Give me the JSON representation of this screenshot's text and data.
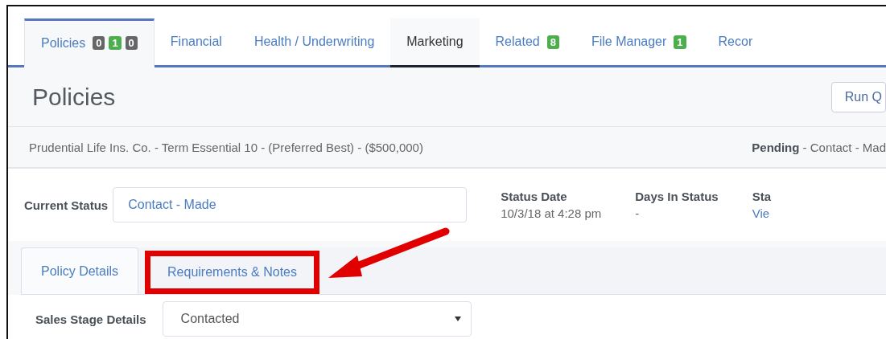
{
  "tabs": [
    {
      "label": "Policies",
      "selected": true,
      "highlighted": false,
      "badges": [
        {
          "text": "0",
          "color": "#666666"
        },
        {
          "text": "1",
          "color": "#4cae4c"
        },
        {
          "text": "0",
          "color": "#666666"
        }
      ]
    },
    {
      "label": "Financial",
      "selected": false,
      "highlighted": false
    },
    {
      "label": "Health / Underwriting",
      "selected": false,
      "highlighted": false
    },
    {
      "label": "Marketing",
      "selected": false,
      "highlighted": true
    },
    {
      "label": "Related",
      "selected": false,
      "highlighted": false,
      "badges": [
        {
          "text": "8",
          "color": "#4cae4c"
        }
      ]
    },
    {
      "label": "File Manager",
      "selected": false,
      "highlighted": false,
      "badges": [
        {
          "text": "1",
          "color": "#4cae4c"
        }
      ]
    },
    {
      "label": "Recor",
      "selected": false,
      "highlighted": false
    }
  ],
  "page_title": "Policies",
  "header_button": "Run Q",
  "policy_summary": "Prudential Life Ins. Co. - Term Essential 10 - (Preferred Best) - ($500,000)",
  "policy_status": "**Pending** - Contact - Mad",
  "current_status": {
    "label": "Current Status",
    "value": "Contact - Made"
  },
  "info": [
    {
      "label": "Status Date",
      "value": "10/3/18 at 4:28 pm",
      "kind": "text"
    },
    {
      "label": "Days In Status",
      "value": "-",
      "kind": "text"
    },
    {
      "label": "Sta",
      "value": "Vie",
      "kind": "link"
    }
  ],
  "subtabs": [
    {
      "label": "Policy Details",
      "selected": true,
      "annotated": false
    },
    {
      "label": "Requirements & Notes",
      "selected": false,
      "annotated": true
    }
  ],
  "sales_stage": {
    "label": "Sales Stage Details",
    "value": "Contacted"
  }
}
